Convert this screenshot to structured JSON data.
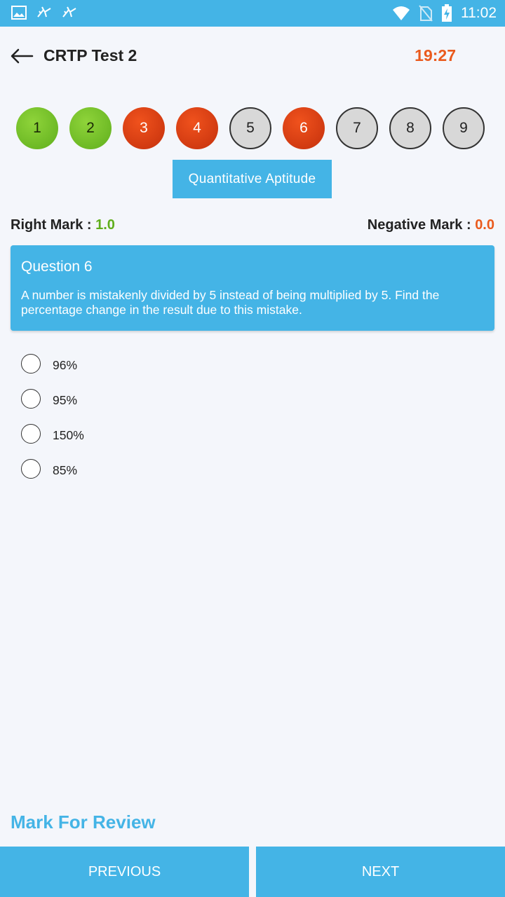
{
  "status_bar": {
    "time": "11:02",
    "icons": [
      "image-icon",
      "notification-icon",
      "notification-icon",
      "wifi-icon",
      "no-sim-icon",
      "battery-charging-icon"
    ]
  },
  "header": {
    "title": "CRTP Test 2",
    "timer": "19:27"
  },
  "question_nav": [
    {
      "number": "1",
      "state": "answered"
    },
    {
      "number": "2",
      "state": "answered"
    },
    {
      "number": "3",
      "state": "wrong"
    },
    {
      "number": "4",
      "state": "wrong"
    },
    {
      "number": "5",
      "state": "unvisited"
    },
    {
      "number": "6",
      "state": "wrong"
    },
    {
      "number": "7",
      "state": "unvisited"
    },
    {
      "number": "8",
      "state": "unvisited"
    },
    {
      "number": "9",
      "state": "unvisited"
    }
  ],
  "section": {
    "label": "Quantitative Aptitude"
  },
  "marks": {
    "right_label": "Right Mark :",
    "right_value": "1.0",
    "negative_label": "Negative Mark :",
    "negative_value": "0.0"
  },
  "question": {
    "title": "Question 6",
    "text": "A number is mistakenly divided by 5 instead of being multiplied by 5. Find the percentage change in the result due to this mistake."
  },
  "options": [
    {
      "label": "96%"
    },
    {
      "label": "95%"
    },
    {
      "label": "150%"
    },
    {
      "label": "85%"
    }
  ],
  "footer": {
    "mark_review": "Mark For Review",
    "previous": "PREVIOUS",
    "next": "NEXT"
  },
  "colors": {
    "primary": "#44b4e6",
    "accent_orange": "#ea5a1d",
    "accent_green": "#5fae1c",
    "background": "#f4f6fb"
  }
}
